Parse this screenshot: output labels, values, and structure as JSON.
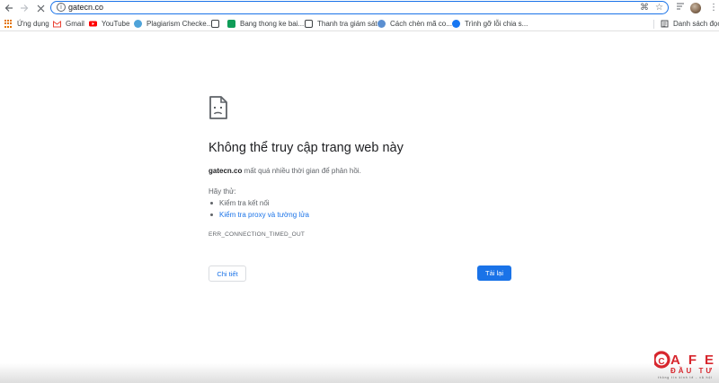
{
  "toolbar": {
    "back_icon": "arrow-left-icon",
    "forward_icon": "arrow-right-icon",
    "stop_icon": "close-icon",
    "url": "gatecn.co",
    "info_icon": "info-icon",
    "extension_icon": "extension-icon",
    "star_icon": "star-icon",
    "reading_list_icon": "reading-list-icon",
    "menu_icon": "menu-icon"
  },
  "bookmarks": {
    "items": [
      {
        "label": "Ứng dụng",
        "icon": "apps-grid-icon"
      },
      {
        "label": "Gmail",
        "icon": "gmail-icon",
        "color": "#ea4335"
      },
      {
        "label": "YouTube",
        "icon": "youtube-icon",
        "color": "#ff0000"
      },
      {
        "label": "Plagiarism Checke...",
        "icon": "plagiarism-icon",
        "color": "#4fa3d9"
      },
      {
        "label": "",
        "icon": "globe-icon"
      },
      {
        "label": "Bang thong ke bai...",
        "icon": "sheets-icon",
        "color": "#0f9d58"
      },
      {
        "label": "Thanh tra giám sát",
        "icon": "globe-icon"
      },
      {
        "label": "Cách chèn mã co...",
        "icon": "site-icon",
        "color": "#5b8fd1"
      },
      {
        "label": "Trình gỡ lỗi chia s...",
        "icon": "facebook-icon",
        "color": "#1877f2"
      }
    ],
    "reading_list": "Danh sách đọc"
  },
  "error": {
    "icon": "sad-page-icon",
    "title": "Không thể truy cập trang web này",
    "host": "gatecn.co",
    "description": "mất quá nhiều thời gian để phản hồi.",
    "try_label": "Hãy thử:",
    "suggestions": [
      "Kiểm tra kết nối",
      "Kiểm tra proxy và tường lửa"
    ],
    "code": "ERR_CONNECTION_TIMED_OUT",
    "details_button": "Chi tiết",
    "reload_button": "Tải lại"
  },
  "watermark": {
    "brand_top": "CAFE",
    "brand_bottom": "ĐẦU TƯ",
    "tagline": "thông tin kinh tế - xã hội",
    "brand_color": "#d7262d"
  }
}
